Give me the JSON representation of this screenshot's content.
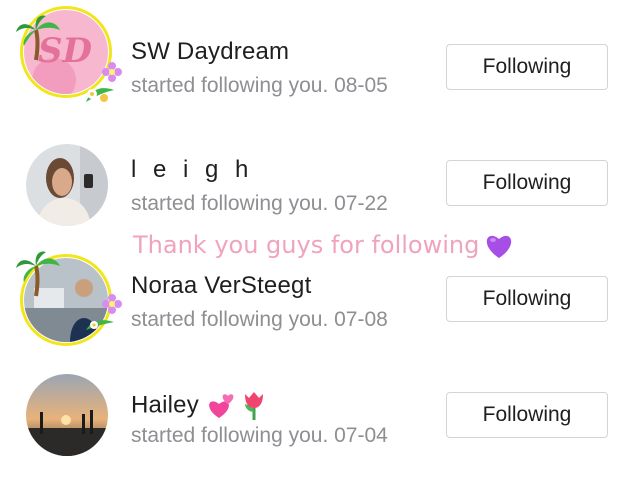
{
  "notifications": [
    {
      "name": "SW Daydream",
      "subtitle": "started following you. 08-05",
      "button": "Following",
      "avatar_initials": "SD"
    },
    {
      "name": "l e i g h",
      "subtitle": "started following you. 07-22",
      "button": "Following"
    },
    {
      "name": "Noraa VerSteegt",
      "subtitle": "started following you. 07-08",
      "button": "Following"
    },
    {
      "name": "Hailey",
      "subtitle": "started following you. 07-04",
      "button": "Following"
    }
  ],
  "overlay_caption": "Thank you guys for following",
  "icons": {
    "caption_emoji": "purple-heart-icon",
    "name_emojis": [
      "two-hearts-icon",
      "tulip-icon"
    ]
  },
  "colors": {
    "caption": "#f0a3bd",
    "frame": "#f2e51c",
    "subtitle": "#8e8e93"
  }
}
